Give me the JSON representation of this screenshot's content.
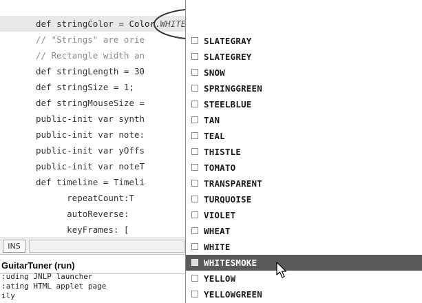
{
  "editor": {
    "partial_top": "  .  .  .  .       .      .",
    "lines": [
      {
        "segments": [
          {
            "t": "def stringColor = ",
            "c": "kw"
          },
          {
            "t": "Color.",
            "c": ""
          },
          {
            "t": "WHITESMOKE",
            "c": "it"
          },
          {
            "t": ";",
            "c": ""
          }
        ],
        "highlight": true
      },
      {
        "segments": [
          {
            "t": "// \"Strings\" are orie",
            "c": "cm"
          }
        ]
      },
      {
        "segments": [
          {
            "t": "// Rectangle width an",
            "c": "cm"
          }
        ]
      },
      {
        "segments": [
          {
            "t": "def stringLength = 30",
            "c": "kw"
          }
        ]
      },
      {
        "segments": [
          {
            "t": "def stringSize = 1;",
            "c": "kw"
          }
        ]
      },
      {
        "segments": [
          {
            "t": "def stringMouseSize =",
            "c": "kw"
          }
        ]
      },
      {
        "segments": [
          {
            "t": "public-init var synth",
            "c": "kw"
          }
        ]
      },
      {
        "segments": [
          {
            "t": "public-init var note:",
            "c": "kw"
          }
        ]
      },
      {
        "segments": [
          {
            "t": "public-init var yOffs",
            "c": "kw"
          }
        ]
      },
      {
        "segments": [
          {
            "t": "public-init var noteT",
            "c": "kw"
          }
        ]
      },
      {
        "segments": [
          {
            "t": "def timeline = Timeli",
            "c": "kw"
          }
        ]
      },
      {
        "segments": [
          {
            "t": "      repeatCount:T",
            "c": "kw"
          }
        ]
      },
      {
        "segments": [
          {
            "t": "      autoReverse: ",
            "c": "kw"
          }
        ]
      },
      {
        "segments": [
          {
            "t": "      keyFrames: [",
            "c": "kw"
          }
        ]
      }
    ]
  },
  "status": {
    "mode": "INS"
  },
  "output": {
    "tab_title": "GuitarTuner (run)",
    "lines": [
      ":uding JNLP launcher",
      ":ating HTML applet page",
      "ily"
    ]
  },
  "completion": {
    "items": [
      "SLATEGRAY",
      "SLATEGREY",
      "SNOW",
      "SPRINGGREEN",
      "STEELBLUE",
      "TAN",
      "TEAL",
      "THISTLE",
      "TOMATO",
      "TRANSPARENT",
      "TURQUOISE",
      "VIOLET",
      "WHEAT",
      "WHITE",
      "WHITESMOKE",
      "YELLOW",
      "YELLOWGREEN"
    ],
    "selected": "WHITESMOKE"
  },
  "icons": {
    "item_icon": "color-swatch-icon",
    "cursor": "mouse-pointer-icon",
    "annotation": "ellipse-highlight-icon"
  },
  "colors": {
    "selection": "#5a5a5a",
    "line_highlight": "#e8e8e8",
    "comment": "#8a8a8a"
  }
}
